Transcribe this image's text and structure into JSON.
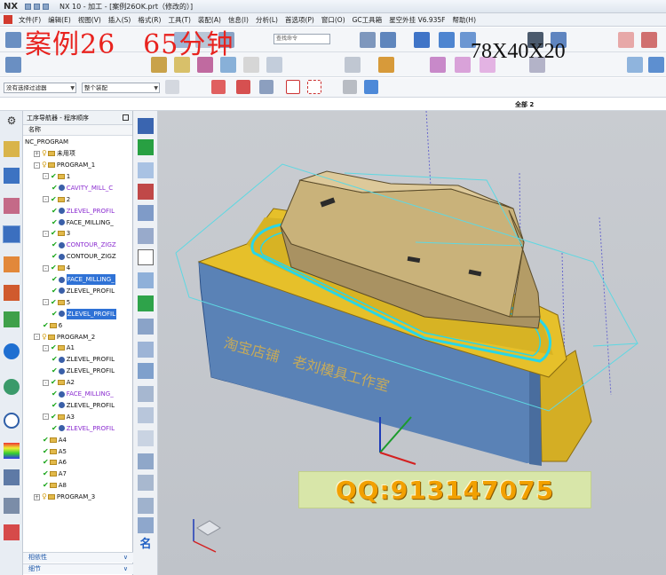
{
  "window": {
    "app_logo": "NX",
    "title": "NX 10 - 加工 - [案例26OK.prt（修改的）]"
  },
  "menu": [
    "文件(F)",
    "编辑(E)",
    "视图(V)",
    "插入(S)",
    "格式(R)",
    "工具(T)",
    "装配(A)",
    "信息(I)",
    "分析(L)",
    "首选项(P)",
    "窗口(O)",
    "GC工具箱",
    "星空外挂 V6.935F",
    "帮助(H)"
  ],
  "toolbar": {
    "find_placeholder": "查找命令",
    "selection_filter": "没有选择过滤器",
    "assembly_scope": "整个装配"
  },
  "overlay": {
    "case_title": "案例26　65分钟",
    "dimensions": "78X40X20",
    "contact": "QQ:913147075",
    "engraving": "淘宝店铺　老刘模具工作室"
  },
  "viewport": {
    "title": "全部 2"
  },
  "navigator": {
    "title": "工序导航器 - 程序顺序",
    "column": "名称",
    "footer_dependency": "相依性",
    "footer_details": "细节",
    "rows": [
      {
        "label": "NC_PROGRAM",
        "indent": 0,
        "type": "root"
      },
      {
        "label": "未用项",
        "indent": 1,
        "type": "folder",
        "toggle": "+"
      },
      {
        "label": "PROGRAM_1",
        "indent": 1,
        "type": "folder",
        "toggle": "-"
      },
      {
        "label": "1",
        "indent": 2,
        "type": "group",
        "toggle": "-"
      },
      {
        "label": "CAVITY_MILL_C",
        "indent": 3,
        "type": "op",
        "style": "purple"
      },
      {
        "label": "2",
        "indent": 2,
        "type": "group",
        "toggle": "-"
      },
      {
        "label": "ZLEVEL_PROFIL",
        "indent": 3,
        "type": "op",
        "style": "purple"
      },
      {
        "label": "FACE_MILLING_",
        "indent": 3,
        "type": "op"
      },
      {
        "label": "3",
        "indent": 2,
        "type": "group",
        "toggle": "-"
      },
      {
        "label": "CONTOUR_ZIGZ",
        "indent": 3,
        "type": "op",
        "style": "purple"
      },
      {
        "label": "CONTOUR_ZIGZ",
        "indent": 3,
        "type": "op"
      },
      {
        "label": "4",
        "indent": 2,
        "type": "group",
        "toggle": "-"
      },
      {
        "label": "FACE_MILLING_",
        "indent": 3,
        "type": "op",
        "style": "selected"
      },
      {
        "label": "ZLEVEL_PROFIL",
        "indent": 3,
        "type": "op"
      },
      {
        "label": "5",
        "indent": 2,
        "type": "group",
        "toggle": "-"
      },
      {
        "label": "ZLEVEL_PROFIL",
        "indent": 3,
        "type": "op",
        "style": "selected"
      },
      {
        "label": "6",
        "indent": 2,
        "type": "group"
      },
      {
        "label": "PROGRAM_2",
        "indent": 1,
        "type": "folder",
        "toggle": "-"
      },
      {
        "label": "A1",
        "indent": 2,
        "type": "group",
        "toggle": "-"
      },
      {
        "label": "ZLEVEL_PROFIL",
        "indent": 3,
        "type": "op"
      },
      {
        "label": "ZLEVEL_PROFIL",
        "indent": 3,
        "type": "op"
      },
      {
        "label": "A2",
        "indent": 2,
        "type": "group",
        "toggle": "-"
      },
      {
        "label": "FACE_MILLING_",
        "indent": 3,
        "type": "op",
        "style": "purple"
      },
      {
        "label": "ZLEVEL_PROFIL",
        "indent": 3,
        "type": "op"
      },
      {
        "label": "A3",
        "indent": 2,
        "type": "group",
        "toggle": "-"
      },
      {
        "label": "ZLEVEL_PROFIL",
        "indent": 3,
        "type": "op",
        "style": "purple"
      },
      {
        "label": "A4",
        "indent": 2,
        "type": "group"
      },
      {
        "label": "A5",
        "indent": 2,
        "type": "group"
      },
      {
        "label": "A6",
        "indent": 2,
        "type": "group"
      },
      {
        "label": "A7",
        "indent": 2,
        "type": "group"
      },
      {
        "label": "A8",
        "indent": 2,
        "type": "group"
      },
      {
        "label": "PROGRAM_3",
        "indent": 1,
        "type": "folder",
        "toggle": "+"
      }
    ]
  },
  "colors": {
    "block_blue": "#5a82b6",
    "block_yellow": "#e6c02a",
    "part_tan": "#c9b27a",
    "toolpath_cyan": "#27d6e8",
    "overlay_red": "#e8231f",
    "watermark_orange": "#f2a000"
  }
}
